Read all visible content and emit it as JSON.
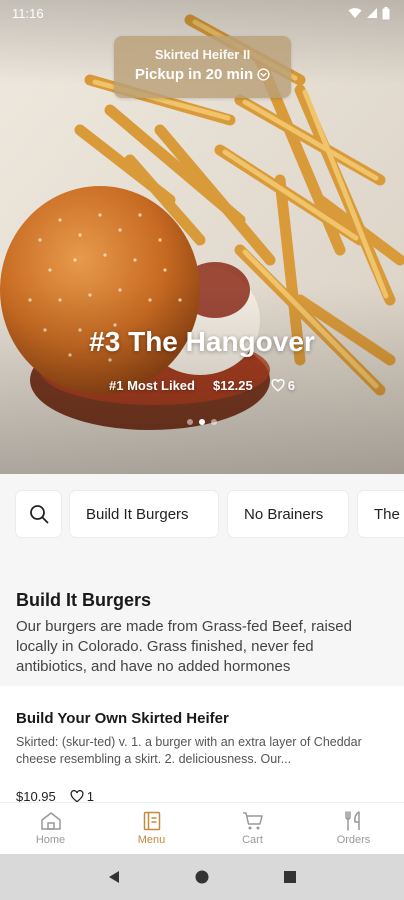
{
  "status_bar": {
    "time": "11:16"
  },
  "pickup": {
    "store": "Skirted Heifer II",
    "time_text": "Pickup in 20 min"
  },
  "hero": {
    "title": "#3 The Hangover",
    "rank": "#1 Most Liked",
    "price": "$12.25",
    "likes": "6",
    "slide_count": 3,
    "active_slide": 1
  },
  "categories": {
    "search_icon": "search-icon",
    "chips": [
      "Build It Burgers",
      "No Brainers",
      "The"
    ]
  },
  "section": {
    "title": "Build It Burgers",
    "description": "Our burgers are made from Grass-fed Beef, raised locally in Colorado. Grass finished, never fed antibiotics, and have no added hormones"
  },
  "item": {
    "name": "Build Your Own Skirted Heifer",
    "description": "Skirted: (skur-ted) v. 1. a burger with an extra layer of Cheddar cheese resembling a skirt. 2. deliciousness. Our...",
    "price": "$10.95",
    "likes": "1"
  },
  "bottom_nav": [
    {
      "label": "Home",
      "icon": "home-icon",
      "active": false
    },
    {
      "label": "Menu",
      "icon": "menu-icon",
      "active": true
    },
    {
      "label": "Cart",
      "icon": "cart-icon",
      "active": false
    },
    {
      "label": "Orders",
      "icon": "orders-icon",
      "active": false
    }
  ],
  "colors": {
    "accent": "#c2893f",
    "pickup_bg": "#baa078"
  }
}
